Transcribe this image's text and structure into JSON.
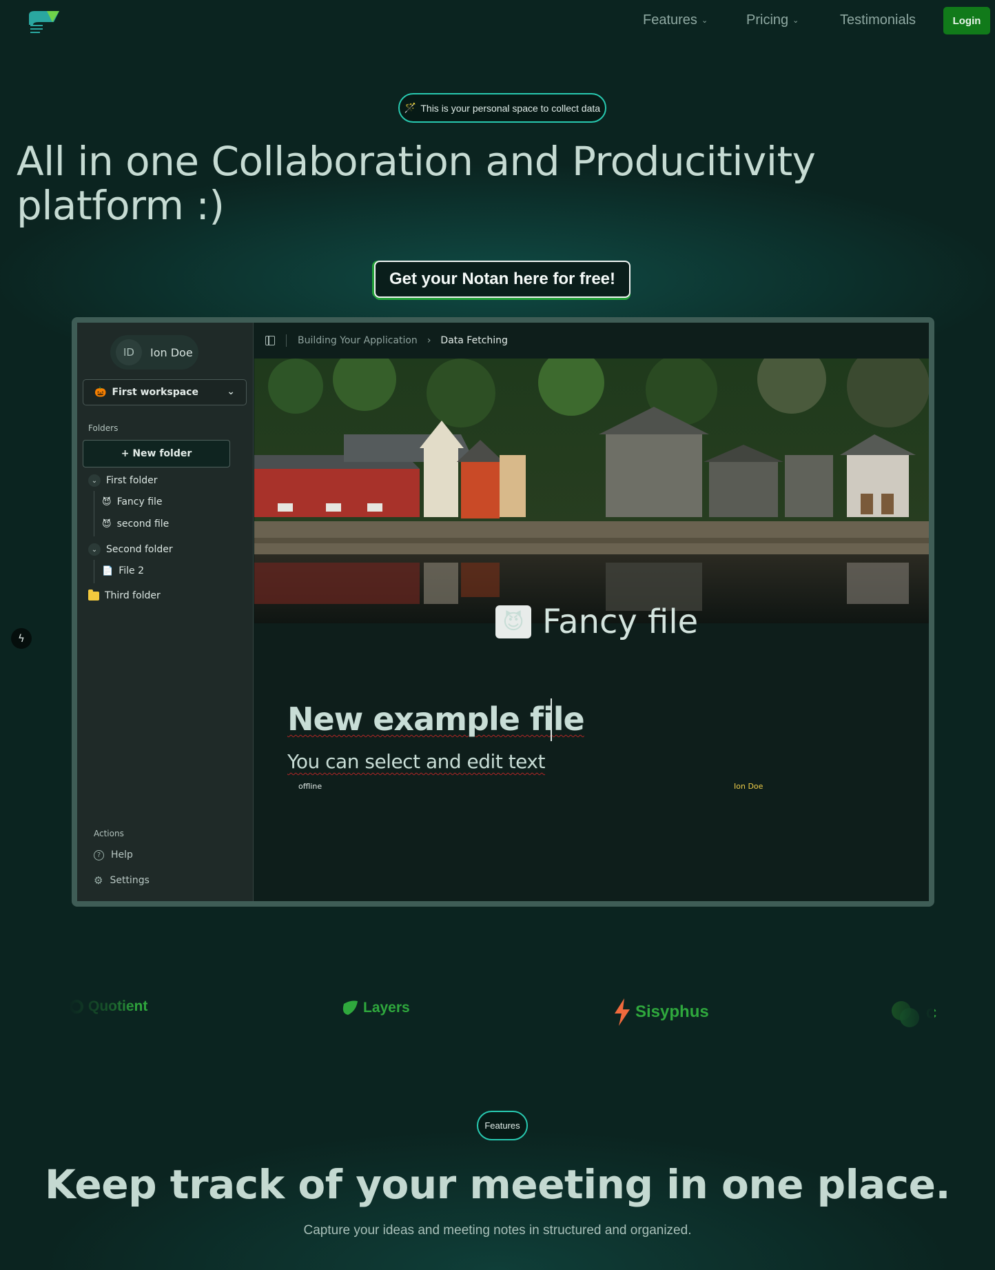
{
  "nav": {
    "items": [
      {
        "label": "Features",
        "has_dropdown": true
      },
      {
        "label": "Pricing",
        "has_dropdown": true
      },
      {
        "label": "Testimonials",
        "has_dropdown": false
      }
    ],
    "login_label": "Login"
  },
  "hero": {
    "badge_icon": "🪄",
    "badge_text": "This is your personal space to collect data",
    "title": "All in one Collaboration and Producitivity platform :)",
    "cta_label": "Get your Notan here for free!"
  },
  "app": {
    "user": {
      "initials": "ID",
      "name": "Ion Doe"
    },
    "workspace": {
      "emoji": "🎃",
      "name": "First workspace"
    },
    "folders_label": "Folders",
    "new_folder_label": "+ New folder",
    "tree": {
      "first_folder": "First folder",
      "fancy_file": {
        "emoji": "😈",
        "label": "Fancy file"
      },
      "second_file": {
        "emoji": "😈",
        "label": "second file"
      },
      "second_folder": "Second folder",
      "file_2": {
        "emoji": "📄",
        "label": "File 2"
      },
      "third_folder": "Third folder"
    },
    "actions_label": "Actions",
    "help_label": "Help",
    "settings_label": "Settings",
    "breadcrumb": {
      "parent": "Building Your Application",
      "current": "Data Fetching"
    },
    "file": {
      "emoji": "😈",
      "title": "Fancy file"
    },
    "doc": {
      "h1": "New example file",
      "h2": "You can select and edit text"
    },
    "status": {
      "connection": "offline",
      "collaborator": "Ion Doe"
    }
  },
  "logos": [
    {
      "name": "Quotient",
      "icon": "quotient-icon"
    },
    {
      "name": "Layers",
      "icon": "layers-icon"
    },
    {
      "name": "Sisyphus",
      "icon": "sisyphus-icon"
    },
    {
      "name": "C",
      "icon": "circles-icon"
    }
  ],
  "features": {
    "badge": "Features",
    "title": "Keep track of your meeting in one place.",
    "subtitle": "Capture your ideas and meeting notes in structured and organized."
  },
  "colors": {
    "background": "#0b2420",
    "accent_green": "#117a1a",
    "badge_border": "#28c9b0",
    "heading": "#c6dbd3",
    "collaborator": "#f0cf4a"
  }
}
